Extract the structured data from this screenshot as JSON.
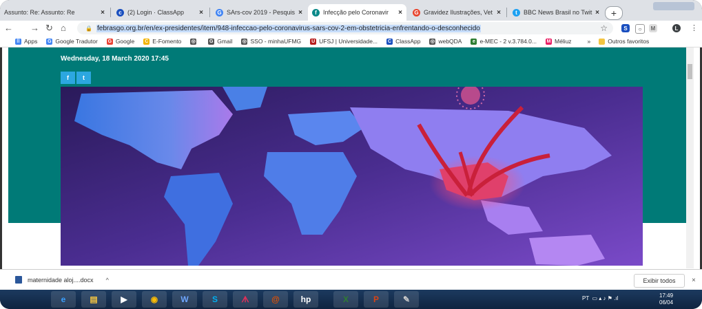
{
  "browser": {
    "tabs": [
      {
        "label": "Assunto: Re: Assunto: Re",
        "icon": "mail-icon",
        "color": "#777777"
      },
      {
        "label": "(2) Login · ClassApp",
        "icon": "classapp-icon",
        "color": "#1a4fbf"
      },
      {
        "label": "SArs-cov 2019 - Pesquis",
        "icon": "google-icon",
        "color": "#4285f4"
      },
      {
        "label": "Infecção pelo Coronavir",
        "icon": "febrasgo-icon",
        "color": "#0b8a8a",
        "active": true
      },
      {
        "label": "Gravidez Ilustrações, Vet",
        "icon": "vector-icon",
        "color": "#e8452e"
      },
      {
        "label": "BBC News Brasil no Twit",
        "icon": "twitter-icon",
        "color": "#1da1f2"
      }
    ],
    "url": "febrasgo.org.br/en/ex-presidentes/item/948-infeccao-pelo-coronavirus-sars-cov-2-em-obstetricia-enfrentando-o-desconhecido",
    "profile_initial": "L",
    "bookmarks": [
      {
        "label": "Apps",
        "color": "#4285f4",
        "glyph": "⠿"
      },
      {
        "label": "Google Tradutor",
        "color": "#4285f4",
        "glyph": "G"
      },
      {
        "label": "Google",
        "color": "#ea4335",
        "glyph": "G"
      },
      {
        "label": "E-Fomento",
        "color": "#f4b400",
        "glyph": "C"
      },
      {
        "label": "",
        "color": "#555555",
        "glyph": "◎"
      },
      {
        "label": "Gmail",
        "color": "#555555",
        "glyph": "G"
      },
      {
        "label": "SSO - minhaUFMG",
        "color": "#555555",
        "glyph": "◎"
      },
      {
        "label": "UFSJ | Universidade...",
        "color": "#b71c1c",
        "glyph": "U"
      },
      {
        "label": "ClassApp",
        "color": "#1a4fbf",
        "glyph": "C"
      },
      {
        "label": "webQDA",
        "color": "#555555",
        "glyph": "◎"
      },
      {
        "label": "e-MEC - 2 v.3.784.0...",
        "color": "#2e7d32",
        "glyph": "e"
      },
      {
        "label": "Méliuz",
        "color": "#e91e63",
        "glyph": "M"
      }
    ],
    "more_bookmarks": "»",
    "other_favorites": "Outros favoritos"
  },
  "article": {
    "date": "Wednesday, 18 March 2020 17:45",
    "share_facebook": "f",
    "share_twitter": "t"
  },
  "download_bar": {
    "file": "maternidade aloj....docx",
    "show_all": "Exibir todos"
  },
  "taskbar": {
    "language": "PT",
    "time": "17:49",
    "date": "06/04"
  },
  "colors": {
    "header_teal": "#007a77",
    "hero_purple": "#6a3fb5",
    "hero_blue": "#3b6fe0",
    "highlight_red": "#e0406b"
  }
}
